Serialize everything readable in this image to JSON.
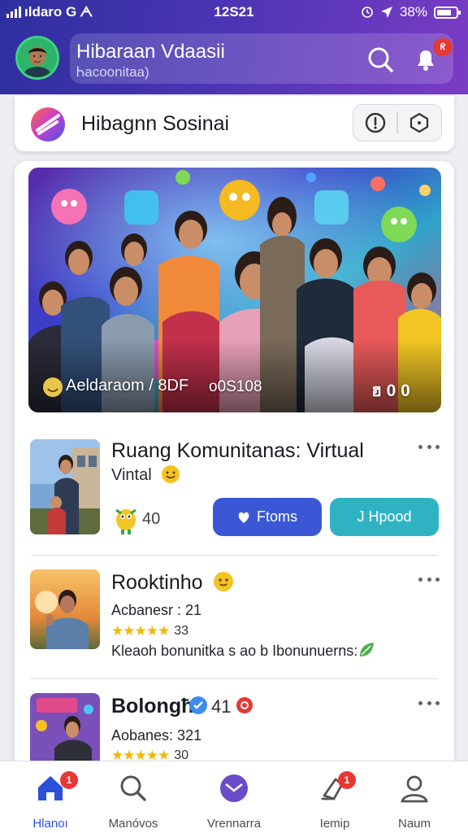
{
  "status_bar": {
    "carrier": "ıldaro G",
    "carrier_glyph": "ᗅ",
    "time": "12S21",
    "battery": "38%"
  },
  "header": {
    "title": "Hibaraan Vdaasii",
    "subtitle": "Ꮒacoonitaa)",
    "notification_count": "ᖇ"
  },
  "section": {
    "title": "Hibagnn Sosinai"
  },
  "hero": {
    "caption": "Aeldaraom / 8DF",
    "middle_text": "o0S108",
    "right_text": "ฮ 0 0"
  },
  "posts": [
    {
      "title": "Ruang Komunitanas: Virtual",
      "subtitle": "Vintal",
      "count": "40",
      "button_primary": "Ftoms",
      "button_secondary": "J Hpood"
    },
    {
      "title": "Rooktinho",
      "author": "Acbanesr : 21",
      "rating_count": "33",
      "description": "Kleaoh bonunitka s ao b Ibonunuerns:"
    },
    {
      "title": "Bolongħ",
      "count": "41",
      "author": "Aobanes: 321",
      "rating_count": "30"
    }
  ],
  "bottom_nav": [
    {
      "label": "Hlanoı",
      "badge": "1",
      "icon": "home-icon"
    },
    {
      "label": "Manóvos",
      "icon": "search-icon"
    },
    {
      "label": "Vrennarra",
      "icon": "mail-icon"
    },
    {
      "label": "Iemip",
      "badge": "1",
      "icon": "bell-icon"
    },
    {
      "label": "Naum",
      "icon": "profile-icon"
    }
  ],
  "colors": {
    "header_gradient_start": "#2e2f9e",
    "header_gradient_end": "#7a3cc4",
    "primary_button": "#3b57d6",
    "secondary_button": "#2fb3c3",
    "badge": "#e53935",
    "active_nav": "#2b4fd8"
  }
}
